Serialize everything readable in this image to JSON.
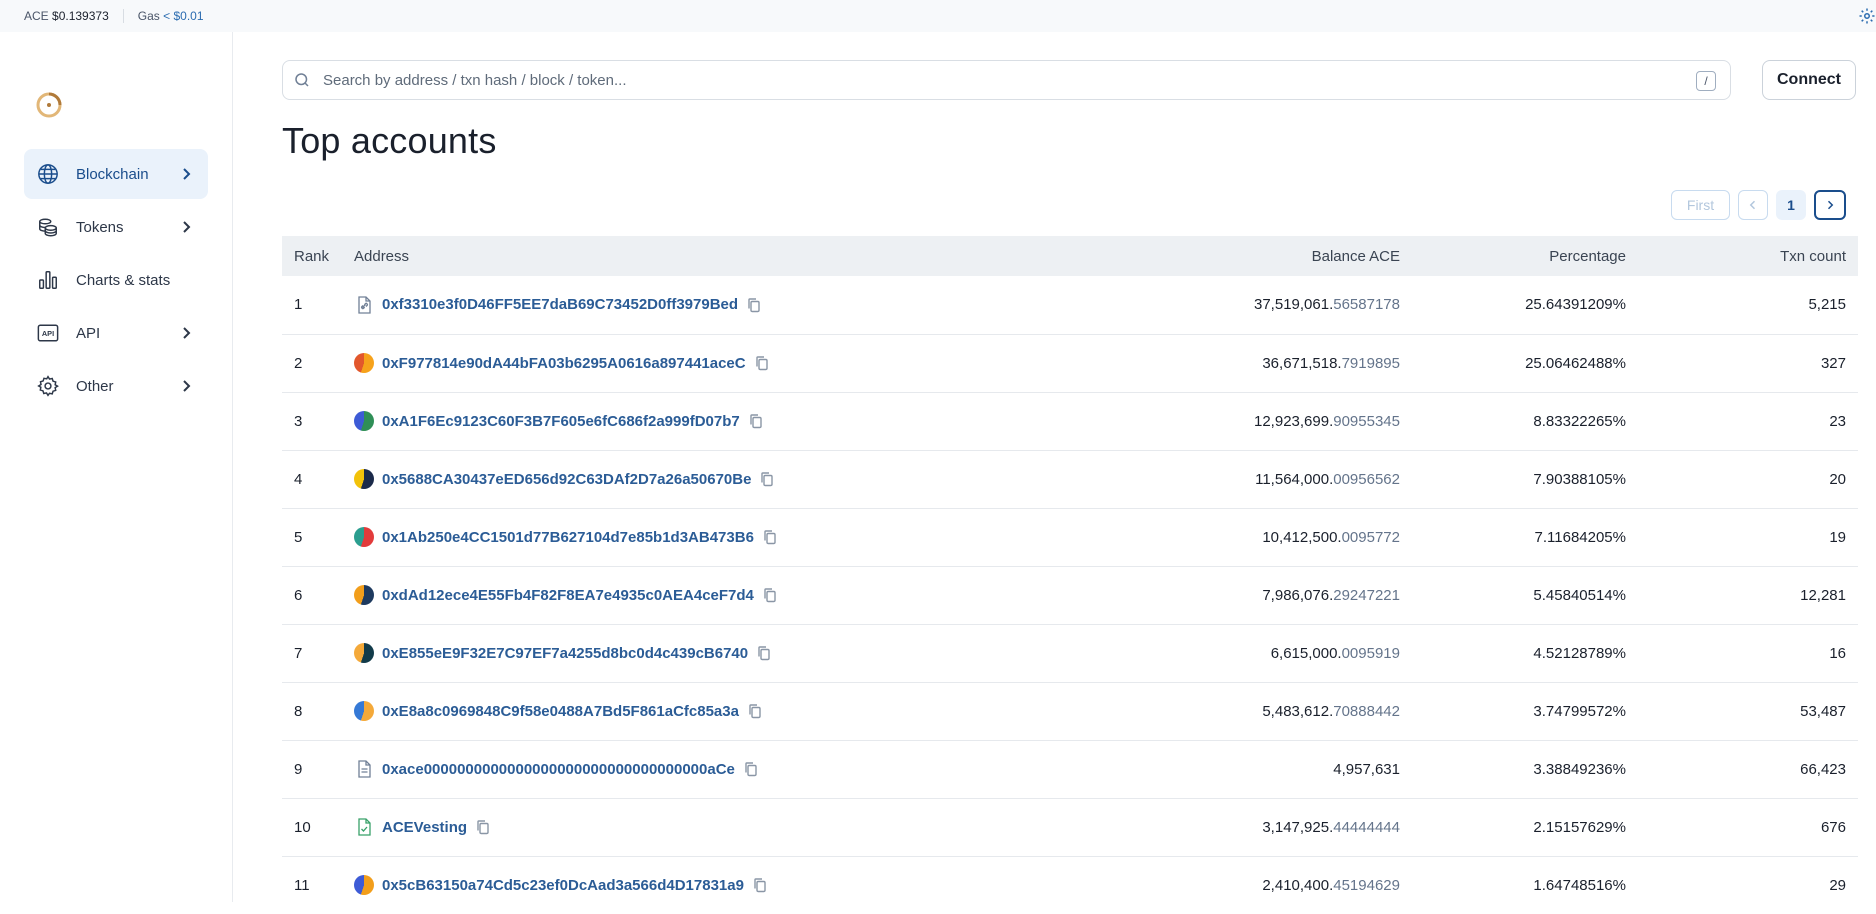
{
  "topbar": {
    "ace_label": "ACE",
    "ace_price": "$0.139373",
    "gas_label": "Gas",
    "gas_value": "< $0.01"
  },
  "sidebar": {
    "items": [
      {
        "label": "Blockchain",
        "icon": "globe-icon",
        "active": true,
        "has_chevron": true
      },
      {
        "label": "Tokens",
        "icon": "coins-icon",
        "active": false,
        "has_chevron": true
      },
      {
        "label": "Charts & stats",
        "icon": "bar-chart-icon",
        "active": false,
        "has_chevron": false
      },
      {
        "label": "API",
        "icon": "api-icon",
        "active": false,
        "has_chevron": true
      },
      {
        "label": "Other",
        "icon": "gear-icon",
        "active": false,
        "has_chevron": true
      }
    ]
  },
  "search": {
    "placeholder": "Search by address / txn hash / block / token...",
    "shortcut": "/"
  },
  "header": {
    "connect_label": "Connect",
    "title": "Top accounts"
  },
  "pagination": {
    "first_label": "First",
    "current_page": "1"
  },
  "table": {
    "columns": [
      "Rank",
      "Address",
      "Balance ACE",
      "Percentage",
      "Txn count"
    ],
    "rows": [
      {
        "rank": "1",
        "icon": "contract-icon",
        "address": "0xf3310e3f0D46FF5EE7daB69C73452D0ff3979Bed",
        "balance_int": "37,519,061.",
        "balance_dec": "56587178",
        "percentage": "25.64391209%",
        "txn_count": "5,215"
      },
      {
        "rank": "2",
        "icon": "avatar",
        "address": "0xF977814e90dA44bFA03b6295A0616a897441aceC",
        "balance_int": "36,671,518.",
        "balance_dec": "7919895",
        "percentage": "25.06462488%",
        "txn_count": "327"
      },
      {
        "rank": "3",
        "icon": "avatar",
        "address": "0xA1F6Ec9123C60F3B7F605e6fC686f2a999fD07b7",
        "balance_int": "12,923,699.",
        "balance_dec": "90955345",
        "percentage": "8.83322265%",
        "txn_count": "23"
      },
      {
        "rank": "4",
        "icon": "avatar",
        "address": "0x5688CA30437eED656d92C63DAf2D7a26a50670Be",
        "balance_int": "11,564,000.",
        "balance_dec": "00956562",
        "percentage": "7.90388105%",
        "txn_count": "20"
      },
      {
        "rank": "5",
        "icon": "avatar",
        "address": "0x1Ab250e4CC1501d77B627104d7e85b1d3AB473B6",
        "balance_int": "10,412,500.",
        "balance_dec": "0095772",
        "percentage": "7.11684205%",
        "txn_count": "19"
      },
      {
        "rank": "6",
        "icon": "avatar",
        "address": "0xdAd12ece4E55Fb4F82F8EA7e4935c0AEA4ceF7d4",
        "balance_int": "7,986,076.",
        "balance_dec": "29247221",
        "percentage": "5.45840514%",
        "txn_count": "12,281"
      },
      {
        "rank": "7",
        "icon": "avatar",
        "address": "0xE855eE9F32E7C97EF7a4255d8bc0d4c439cB6740",
        "balance_int": "6,615,000.",
        "balance_dec": "0095919",
        "percentage": "4.52128789%",
        "txn_count": "16"
      },
      {
        "rank": "8",
        "icon": "avatar",
        "address": "0xE8a8c0969848C9f58e0488A7Bd5F861aCfc85a3a",
        "balance_int": "5,483,612.",
        "balance_dec": "70888442",
        "percentage": "3.74799572%",
        "txn_count": "53,487"
      },
      {
        "rank": "9",
        "icon": "document-icon",
        "address": "0xace0000000000000000000000000000000000aCe",
        "balance_int": "4,957,631",
        "balance_dec": "",
        "percentage": "3.38849236%",
        "txn_count": "66,423"
      },
      {
        "rank": "10",
        "icon": "verified-contract-icon",
        "address": "ACEVesting",
        "balance_int": "3,147,925.",
        "balance_dec": "44444444",
        "percentage": "2.15157629%",
        "txn_count": "676"
      },
      {
        "rank": "11",
        "icon": "avatar",
        "address": "0x5cB63150a74Cd5c23ef0DcAad3a566d4D17831a9",
        "balance_int": "2,410,400.",
        "balance_dec": "45194629",
        "percentage": "1.64748516%",
        "txn_count": "29"
      }
    ]
  },
  "colors": {
    "accent": "#1a4d8c",
    "link": "#2b5c96",
    "active_bg": "#eaf2fb"
  }
}
